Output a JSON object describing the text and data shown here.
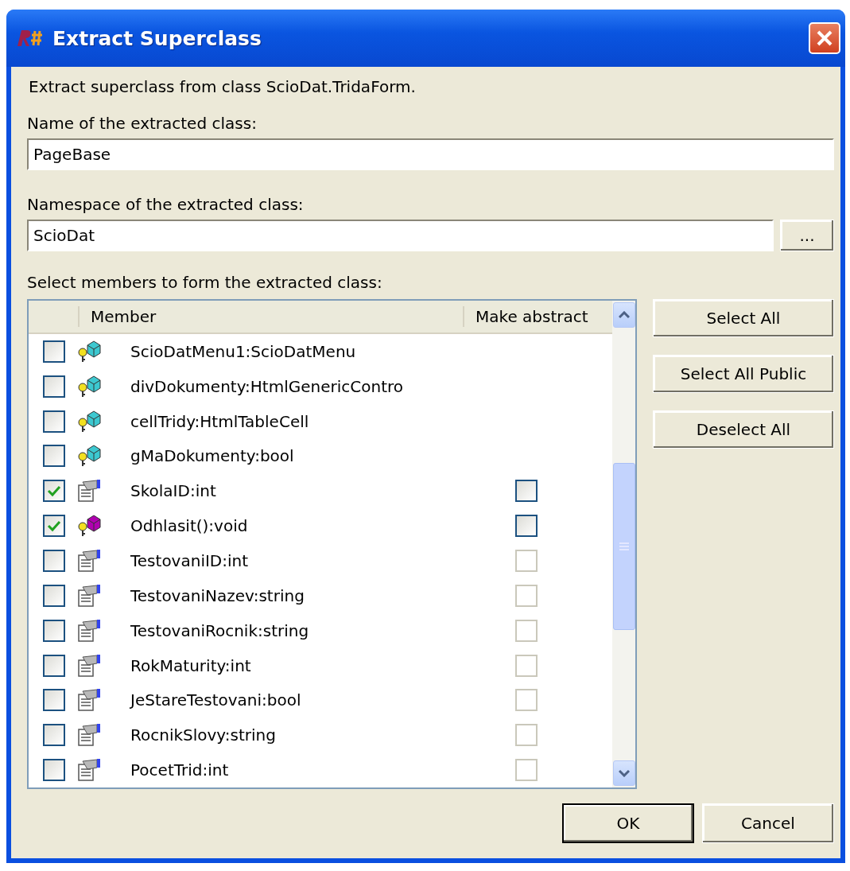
{
  "window": {
    "title": "Extract Superclass"
  },
  "intro": "Extract superclass from class ScioDat.TridaForm.",
  "name_field": {
    "label": "Name of the extracted class:",
    "value": "PageBase"
  },
  "namespace_field": {
    "label": "Namespace of the extracted class:",
    "value": "ScioDat",
    "browse": "..."
  },
  "members_label": "Select members to form the extracted class:",
  "table": {
    "columns": [
      "Member",
      "Make abstract"
    ],
    "rows": [
      {
        "name": "ScioDatMenu1:ScioDatMenu",
        "kind": "field",
        "checked": false
      },
      {
        "name": "divDokumenty:HtmlGenericContro",
        "kind": "field",
        "checked": false
      },
      {
        "name": "cellTridy:HtmlTableCell",
        "kind": "field",
        "checked": false
      },
      {
        "name": "gMaDokumenty:bool",
        "kind": "field",
        "checked": false
      },
      {
        "name": "SkolaID:int",
        "kind": "property",
        "checked": true,
        "abstract_checked": false,
        "abstract_disabled": false
      },
      {
        "name": "Odhlasit():void",
        "kind": "method",
        "checked": true,
        "abstract_checked": false,
        "abstract_disabled": false
      },
      {
        "name": "TestovaniID:int",
        "kind": "property",
        "checked": false,
        "abstract_checked": false,
        "abstract_disabled": true
      },
      {
        "name": "TestovaniNazev:string",
        "kind": "property",
        "checked": false,
        "abstract_checked": false,
        "abstract_disabled": true
      },
      {
        "name": "TestovaniRocnik:string",
        "kind": "property",
        "checked": false,
        "abstract_checked": false,
        "abstract_disabled": true
      },
      {
        "name": "RokMaturity:int",
        "kind": "property",
        "checked": false,
        "abstract_checked": false,
        "abstract_disabled": true
      },
      {
        "name": "JeStareTestovani:bool",
        "kind": "property",
        "checked": false,
        "abstract_checked": false,
        "abstract_disabled": true
      },
      {
        "name": "RocnikSlovy:string",
        "kind": "property",
        "checked": false,
        "abstract_checked": false,
        "abstract_disabled": true
      },
      {
        "name": "PocetTrid:int",
        "kind": "property",
        "checked": false,
        "abstract_checked": false,
        "abstract_disabled": true
      }
    ]
  },
  "side_buttons": [
    "Select All",
    "Select All Public",
    "Deselect All"
  ],
  "buttons": [
    {
      "label": "OK",
      "default": true
    },
    {
      "label": "Cancel",
      "default": false
    }
  ]
}
